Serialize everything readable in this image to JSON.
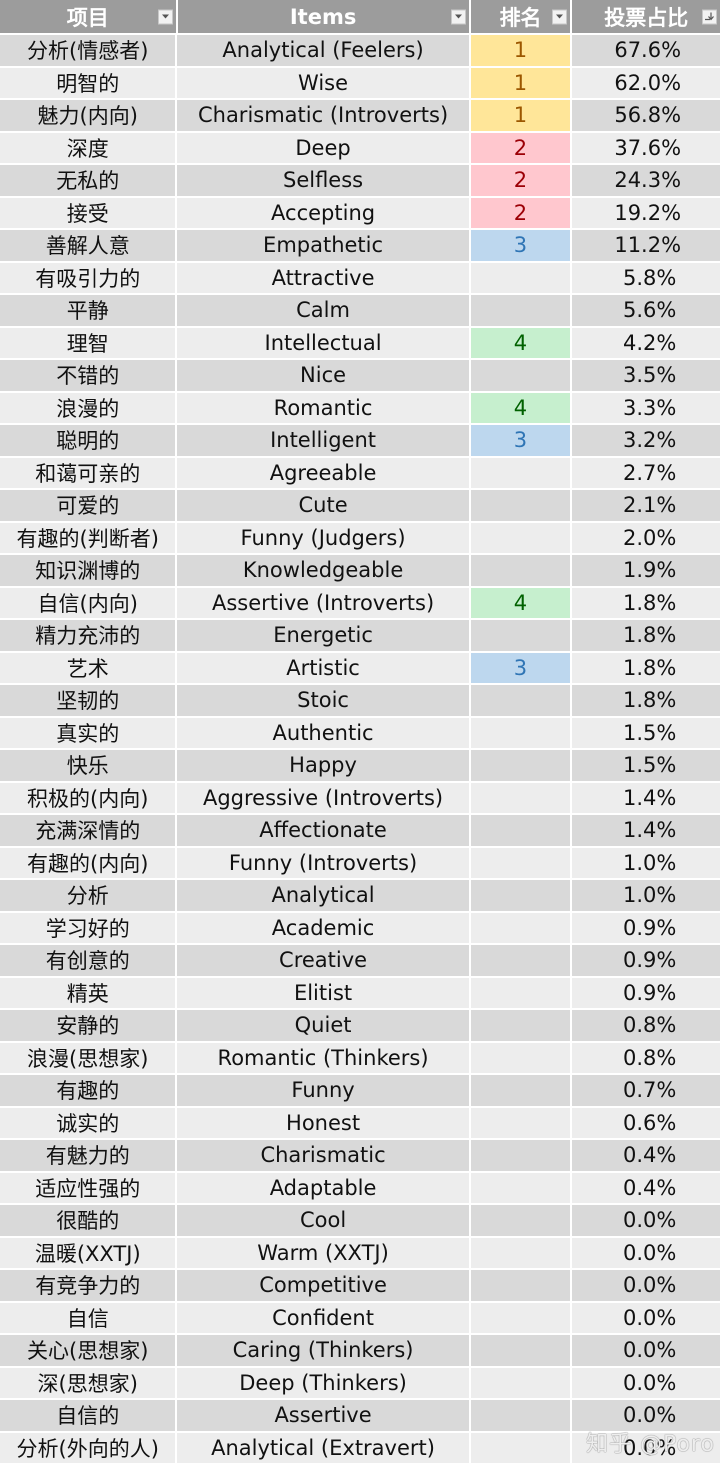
{
  "header": {
    "col_zh": "项目",
    "col_en": "Items",
    "col_rank": "排名",
    "col_pct": "投票占比",
    "filter_icons": [
      "filter-dropdown-icon",
      "filter-dropdown-icon",
      "filter-dropdown-icon",
      "sort-descending-filter-icon"
    ]
  },
  "rank_colors": {
    "1": {
      "bg": "#ffe699",
      "fg": "#9c5700"
    },
    "2": {
      "bg": "#ffc7ce",
      "fg": "#9c0006"
    },
    "3": {
      "bg": "#bdd7ee",
      "fg": "#2f75b5"
    },
    "4": {
      "bg": "#c6efce",
      "fg": "#006100"
    }
  },
  "rows": [
    {
      "zh": "分析(情感者)",
      "en": "Analytical (Feelers)",
      "rank": "1",
      "pct": "67.6%"
    },
    {
      "zh": "明智的",
      "en": "Wise",
      "rank": "1",
      "pct": "62.0%"
    },
    {
      "zh": "魅力(内向)",
      "en": "Charismatic (Introverts)",
      "rank": "1",
      "pct": "56.8%"
    },
    {
      "zh": "深度",
      "en": "Deep",
      "rank": "2",
      "pct": "37.6%"
    },
    {
      "zh": "无私的",
      "en": "Selfless",
      "rank": "2",
      "pct": "24.3%"
    },
    {
      "zh": "接受",
      "en": "Accepting",
      "rank": "2",
      "pct": "19.2%"
    },
    {
      "zh": "善解人意",
      "en": "Empathetic",
      "rank": "3",
      "pct": "11.2%"
    },
    {
      "zh": "有吸引力的",
      "en": "Attractive",
      "rank": "",
      "pct": "5.8%"
    },
    {
      "zh": "平静",
      "en": "Calm",
      "rank": "",
      "pct": "5.6%"
    },
    {
      "zh": "理智",
      "en": "Intellectual",
      "rank": "4",
      "pct": "4.2%"
    },
    {
      "zh": "不错的",
      "en": "Nice",
      "rank": "",
      "pct": "3.5%"
    },
    {
      "zh": "浪漫的",
      "en": "Romantic",
      "rank": "4",
      "pct": "3.3%"
    },
    {
      "zh": "聪明的",
      "en": "Intelligent",
      "rank": "3",
      "pct": "3.2%"
    },
    {
      "zh": "和蔼可亲的",
      "en": "Agreeable",
      "rank": "",
      "pct": "2.7%"
    },
    {
      "zh": "可爱的",
      "en": "Cute",
      "rank": "",
      "pct": "2.1%"
    },
    {
      "zh": "有趣的(判断者)",
      "en": "Funny (Judgers)",
      "rank": "",
      "pct": "2.0%"
    },
    {
      "zh": "知识渊博的",
      "en": "Knowledgeable",
      "rank": "",
      "pct": "1.9%"
    },
    {
      "zh": "自信(内向)",
      "en": "Assertive (Introverts)",
      "rank": "4",
      "pct": "1.8%"
    },
    {
      "zh": "精力充沛的",
      "en": "Energetic",
      "rank": "",
      "pct": "1.8%"
    },
    {
      "zh": "艺术",
      "en": "Artistic",
      "rank": "3",
      "pct": "1.8%"
    },
    {
      "zh": "坚韧的",
      "en": "Stoic",
      "rank": "",
      "pct": "1.8%"
    },
    {
      "zh": "真实的",
      "en": "Authentic",
      "rank": "",
      "pct": "1.5%"
    },
    {
      "zh": "快乐",
      "en": "Happy",
      "rank": "",
      "pct": "1.5%"
    },
    {
      "zh": "积极的(内向)",
      "en": "Aggressive (Introverts)",
      "rank": "",
      "pct": "1.4%"
    },
    {
      "zh": "充满深情的",
      "en": "Affectionate",
      "rank": "",
      "pct": "1.4%"
    },
    {
      "zh": "有趣的(内向)",
      "en": "Funny (Introverts)",
      "rank": "",
      "pct": "1.0%"
    },
    {
      "zh": "分析",
      "en": "Analytical",
      "rank": "",
      "pct": "1.0%"
    },
    {
      "zh": "学习好的",
      "en": "Academic",
      "rank": "",
      "pct": "0.9%"
    },
    {
      "zh": "有创意的",
      "en": "Creative",
      "rank": "",
      "pct": "0.9%"
    },
    {
      "zh": "精英",
      "en": "Elitist",
      "rank": "",
      "pct": "0.9%"
    },
    {
      "zh": "安静的",
      "en": "Quiet",
      "rank": "",
      "pct": "0.8%"
    },
    {
      "zh": "浪漫(思想家)",
      "en": "Romantic (Thinkers)",
      "rank": "",
      "pct": "0.8%"
    },
    {
      "zh": "有趣的",
      "en": "Funny",
      "rank": "",
      "pct": "0.7%"
    },
    {
      "zh": "诚实的",
      "en": "Honest",
      "rank": "",
      "pct": "0.6%"
    },
    {
      "zh": "有魅力的",
      "en": "Charismatic",
      "rank": "",
      "pct": "0.4%"
    },
    {
      "zh": "适应性强的",
      "en": "Adaptable",
      "rank": "",
      "pct": "0.4%"
    },
    {
      "zh": "很酷的",
      "en": "Cool",
      "rank": "",
      "pct": "0.0%"
    },
    {
      "zh": "温暖(XXTJ)",
      "en": "Warm (XXTJ)",
      "rank": "",
      "pct": "0.0%"
    },
    {
      "zh": "有竞争力的",
      "en": "Competitive",
      "rank": "",
      "pct": "0.0%"
    },
    {
      "zh": "自信",
      "en": "Confident",
      "rank": "",
      "pct": "0.0%"
    },
    {
      "zh": "关心(思想家)",
      "en": "Caring (Thinkers)",
      "rank": "",
      "pct": "0.0%"
    },
    {
      "zh": "深(思想家)",
      "en": "Deep (Thinkers)",
      "rank": "",
      "pct": "0.0%"
    },
    {
      "zh": "自信的",
      "en": "Assertive",
      "rank": "",
      "pct": "0.0%"
    },
    {
      "zh": "分析(外向的人)",
      "en": "Analytical (Extravert)",
      "rank": "",
      "pct": "0.0%"
    }
  ],
  "watermark": "知乎 @Poro"
}
